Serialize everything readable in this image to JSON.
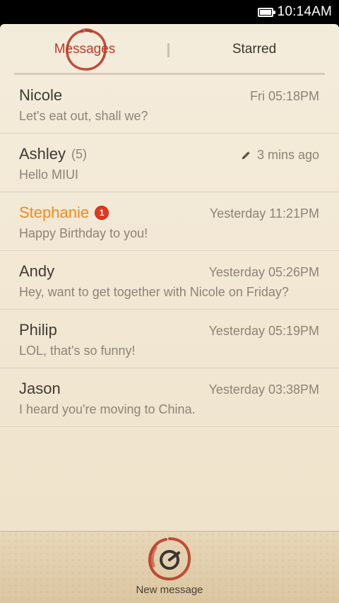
{
  "status_bar": {
    "time": "10:14AM"
  },
  "tabs": [
    {
      "label": "Messages",
      "active": true
    },
    {
      "label": "Starred",
      "active": false
    }
  ],
  "threads": [
    {
      "name": "Nicole",
      "count": "",
      "badge": "",
      "time": "Fri 05:18PM",
      "preview": "Let's eat out, shall we?",
      "draft": false,
      "unread": false
    },
    {
      "name": "Ashley",
      "count": "(5)",
      "badge": "",
      "time": "3 mins ago",
      "preview": "Hello MIUI",
      "draft": true,
      "unread": false
    },
    {
      "name": "Stephanie",
      "count": "",
      "badge": "1",
      "time": "Yesterday 11:21PM",
      "preview": "Happy Birthday to you!",
      "draft": false,
      "unread": true
    },
    {
      "name": "Andy",
      "count": "",
      "badge": "",
      "time": "Yesterday 05:26PM",
      "preview": "Hey, want to get together with Nicole on Friday?",
      "draft": false,
      "unread": false
    },
    {
      "name": "Philip",
      "count": "",
      "badge": "",
      "time": "Yesterday 05:19PM",
      "preview": "LOL, that's so funny!",
      "draft": false,
      "unread": false
    },
    {
      "name": "Jason",
      "count": "",
      "badge": "",
      "time": "Yesterday 03:38PM",
      "preview": "I heard you're moving to China.",
      "draft": false,
      "unread": false
    }
  ],
  "bottom": {
    "new_message_label": "New message"
  },
  "colors": {
    "accent": "#c0392b",
    "unread_name": "#f08a1e",
    "badge": "#e2361f",
    "background": "#f3ead8"
  },
  "icons": {
    "battery": "battery-icon",
    "draft": "pencil-icon",
    "compose": "compose-icon"
  }
}
